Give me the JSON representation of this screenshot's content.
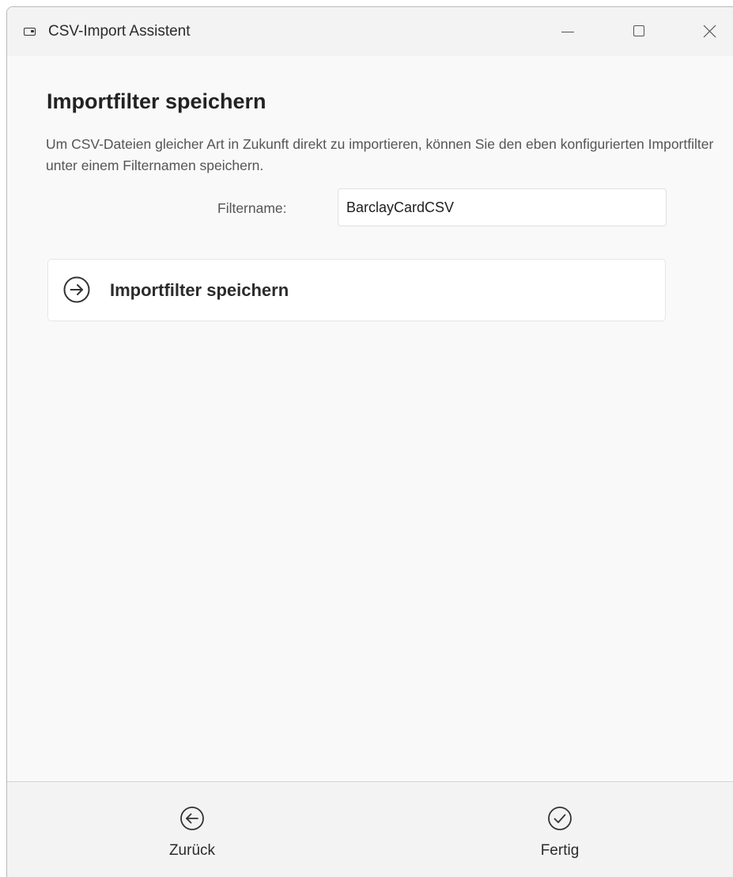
{
  "window": {
    "title": "CSV-Import Assistent"
  },
  "main": {
    "heading": "Importfilter speichern",
    "description": "Um CSV-Dateien gleicher Art in Zukunft direkt zu importieren, können Sie den eben konfigurierten Importfilter unter einem Filternamen speichern.",
    "filter_label": "Filtername:",
    "filter_value": "BarclayCardCSV",
    "action_label": "Importfilter speichern"
  },
  "footer": {
    "back_label": "Zurück",
    "done_label": "Fertig"
  },
  "icons": {
    "app": "window-icon",
    "minimize": "minimize-icon",
    "maximize": "maximize-icon",
    "close": "close-icon",
    "action": "arrow-right-circle-icon",
    "back": "arrow-left-circle-icon",
    "done": "check-circle-icon"
  },
  "colors": {
    "window_bg": "#f9f9f9",
    "titlebar_bg": "#f3f3f3",
    "footer_bg": "#f3f3f3",
    "text_primary": "#222222",
    "text_secondary": "#555555"
  }
}
